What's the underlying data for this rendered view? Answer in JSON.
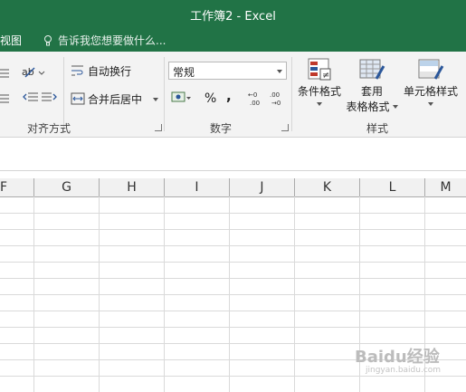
{
  "window": {
    "title": "工作簿2 - Excel"
  },
  "tabs": {
    "view": "视图",
    "tell_me": "告诉我您想要做什么..."
  },
  "ribbon": {
    "alignment": {
      "wrap_text": "自动换行",
      "merge_center": "合并后居中",
      "label": "对齐方式"
    },
    "number": {
      "format_value": "常规",
      "percent": "%",
      "comma": ",",
      "label": "数字"
    },
    "styles": {
      "conditional_format": "条件格式",
      "table_format_1": "套用",
      "table_format_2": "表格格式",
      "cell_styles": "单元格样式",
      "label": "样式"
    }
  },
  "columns": [
    "F",
    "G",
    "H",
    "I",
    "J",
    "K",
    "L",
    "M"
  ],
  "watermark": {
    "text": "Baidu经验",
    "url": "jingyan.baidu.com"
  },
  "colors": {
    "ribbon_green": "#217346",
    "ribbon_bg": "#f3f3f3"
  }
}
